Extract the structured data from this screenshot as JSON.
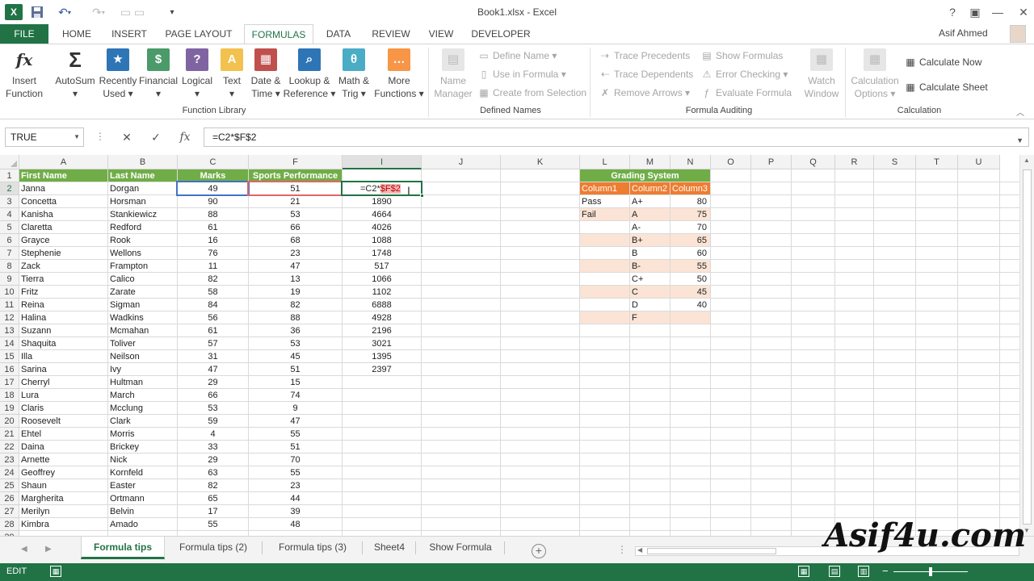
{
  "titlebar": {
    "logo": "X",
    "title": "Book1.xlsx - Excel",
    "user": "Asif Ahmed",
    "icons": [
      "excel-logo-icon",
      "save-icon",
      "undo-icon",
      "redo-icon",
      "open-icon",
      "help-icon",
      "restore-icon",
      "minimize-icon",
      "maximize-icon",
      "close-icon"
    ]
  },
  "tabs": [
    "FILE",
    "HOME",
    "INSERT",
    "PAGE LAYOUT",
    "FORMULAS",
    "DATA",
    "REVIEW",
    "VIEW",
    "DEVELOPER"
  ],
  "ribbon": {
    "function_library": {
      "label": "Function Library",
      "buttons": [
        {
          "l1": "Insert",
          "l2": "Function",
          "glyph": "fx"
        },
        {
          "l1": "AutoSum",
          "l2": "▾",
          "glyph": "Σ"
        },
        {
          "l1": "Recently",
          "l2": "Used ▾",
          "glyph": "★"
        },
        {
          "l1": "Financial",
          "l2": "▾",
          "glyph": "$"
        },
        {
          "l1": "Logical",
          "l2": "▾",
          "glyph": "?"
        },
        {
          "l1": "Text",
          "l2": "▾",
          "glyph": "A"
        },
        {
          "l1": "Date &",
          "l2": "Time ▾",
          "glyph": "▦"
        },
        {
          "l1": "Lookup &",
          "l2": "Reference ▾",
          "glyph": "⌕"
        },
        {
          "l1": "Math &",
          "l2": "Trig ▾",
          "glyph": "θ"
        },
        {
          "l1": "More",
          "l2": "Functions ▾",
          "glyph": "…"
        }
      ]
    },
    "defined_names": {
      "label": "Defined Names",
      "name_manager_l1": "Name",
      "name_manager_l2": "Manager",
      "items": [
        "Define Name ▾",
        "Use in Formula ▾",
        "Create from Selection"
      ]
    },
    "formula_auditing": {
      "label": "Formula Auditing",
      "items": [
        "Trace Precedents",
        "Trace Dependents",
        "Remove Arrows ▾",
        "Show Formulas",
        "Error Checking ▾",
        "Evaluate Formula"
      ],
      "watch_l1": "Watch",
      "watch_l2": "Window"
    },
    "calculation": {
      "label": "Calculation",
      "options_l1": "Calculation",
      "options_l2": "Options ▾",
      "items": [
        "Calculate Now",
        "Calculate Sheet"
      ]
    }
  },
  "formula_bar": {
    "name_box": "TRUE",
    "cancel": "✕",
    "enter": "✓",
    "fx": "fx",
    "formula": "=C2*$F$2"
  },
  "columns": [
    "A",
    "B",
    "C",
    "F",
    "I",
    "J",
    "K",
    "L",
    "M",
    "N",
    "O",
    "P",
    "Q",
    "R",
    "S",
    "T",
    "U"
  ],
  "rows": [
    1,
    2,
    3,
    4,
    5,
    6,
    7,
    8,
    9,
    10,
    11,
    12,
    13,
    14,
    15,
    16,
    17,
    18,
    19,
    20,
    21,
    22,
    23,
    24,
    25,
    26,
    27,
    28,
    29
  ],
  "headers": {
    "first": "First Name",
    "last": "Last Name",
    "marks": "Marks",
    "sports": "Sports Performance"
  },
  "table": [
    [
      "Janna",
      "Dorgan",
      "49",
      "51",
      ""
    ],
    [
      "Concetta",
      "Horsman",
      "90",
      "21",
      "1890"
    ],
    [
      "Kanisha",
      "Stankiewicz",
      "88",
      "53",
      "4664"
    ],
    [
      "Claretta",
      "Redford",
      "61",
      "66",
      "4026"
    ],
    [
      "Grayce",
      "Rook",
      "16",
      "68",
      "1088"
    ],
    [
      "Stephenie",
      "Wellons",
      "76",
      "23",
      "1748"
    ],
    [
      "Zack",
      "Frampton",
      "11",
      "47",
      "517"
    ],
    [
      "Tierra",
      "Calico",
      "82",
      "13",
      "1066"
    ],
    [
      "Fritz",
      "Zarate",
      "58",
      "19",
      "1102"
    ],
    [
      "Reina",
      "Sigman",
      "84",
      "82",
      "6888"
    ],
    [
      "Halina",
      "Wadkins",
      "56",
      "88",
      "4928"
    ],
    [
      "Suzann",
      "Mcmahan",
      "61",
      "36",
      "2196"
    ],
    [
      "Shaquita",
      "Toliver",
      "57",
      "53",
      "3021"
    ],
    [
      "Illa",
      "Neilson",
      "31",
      "45",
      "1395"
    ],
    [
      "Sarina",
      "Ivy",
      "47",
      "51",
      "2397"
    ],
    [
      "Cherryl",
      "Hultman",
      "29",
      "15",
      ""
    ],
    [
      "Lura",
      "March",
      "66",
      "74",
      ""
    ],
    [
      "Claris",
      "Mcclung",
      "53",
      "9",
      ""
    ],
    [
      "Roosevelt",
      "Clark",
      "59",
      "47",
      ""
    ],
    [
      "Ehtel",
      "Morris",
      "4",
      "55",
      ""
    ],
    [
      "Daina",
      "Brickey",
      "33",
      "51",
      ""
    ],
    [
      "Arnette",
      "Nick",
      "29",
      "70",
      ""
    ],
    [
      "Geoffrey",
      "Kornfeld",
      "63",
      "55",
      ""
    ],
    [
      "Shaun",
      "Easter",
      "82",
      "23",
      ""
    ],
    [
      "Margherita",
      "Ortmann",
      "65",
      "44",
      ""
    ],
    [
      "Merilyn",
      "Belvin",
      "17",
      "39",
      ""
    ],
    [
      "Kimbra",
      "Amado",
      "55",
      "48",
      ""
    ]
  ],
  "edit_cell": {
    "prefix": "=C2*",
    "ref": "$F$2"
  },
  "grading": {
    "title": "Grading System",
    "headers": [
      "Column1",
      "Column2",
      "Column3"
    ],
    "rows": [
      [
        "Pass",
        "A+",
        "80"
      ],
      [
        "Fail",
        "A",
        "75"
      ],
      [
        "",
        "A-",
        "70"
      ],
      [
        "",
        "B+",
        "65"
      ],
      [
        "",
        "B",
        "60"
      ],
      [
        "",
        "B-",
        "55"
      ],
      [
        "",
        "C+",
        "50"
      ],
      [
        "",
        "C",
        "45"
      ],
      [
        "",
        "D",
        "40"
      ],
      [
        "",
        "F",
        ""
      ]
    ]
  },
  "sheets": [
    "Formula tips",
    "Formula tips (2)",
    "Formula tips (3)",
    "Sheet4",
    "Show Formula"
  ],
  "active_sheet": "Formula tips",
  "status": {
    "mode": "EDIT"
  },
  "watermark": "Asif4u.com",
  "colors": {
    "accent": "#217346",
    "green_header": "#70ad47",
    "orange_header": "#ed7d31",
    "peach": "#fbe4d5"
  }
}
